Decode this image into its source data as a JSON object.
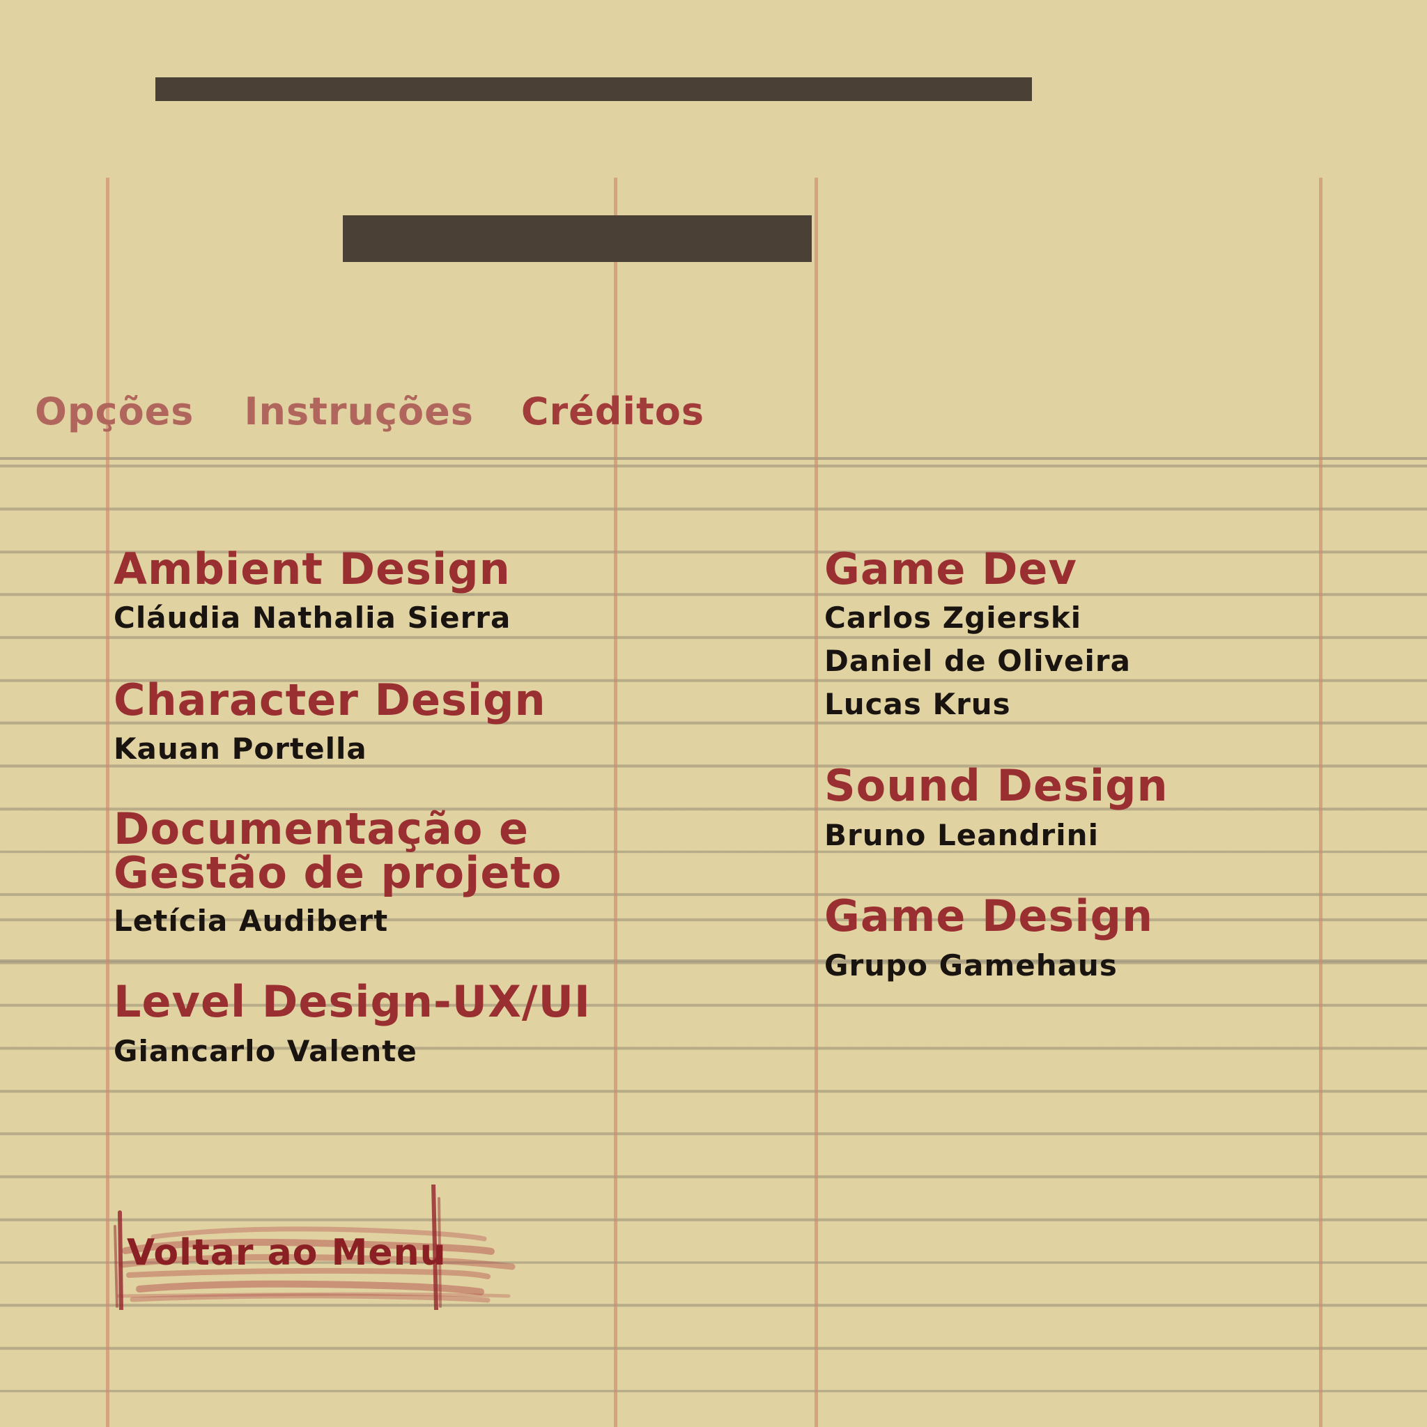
{
  "tabs": [
    {
      "label": "Opções",
      "active": false
    },
    {
      "label": "Instruções",
      "active": false
    },
    {
      "label": "Créditos",
      "active": true
    }
  ],
  "credits_left": [
    {
      "title": "Ambient Design",
      "names": [
        "Cláudia Nathalia Sierra"
      ]
    },
    {
      "title": "Character Design",
      "names": [
        "Kauan Portella"
      ]
    },
    {
      "title_lines": [
        "Documentação e",
        "Gestão de projeto"
      ],
      "names": [
        "Letícia Audibert"
      ]
    },
    {
      "title": "Level Design-UX/UI",
      "names": [
        "Giancarlo Valente"
      ]
    }
  ],
  "credits_right": [
    {
      "title": "Game Dev",
      "names": [
        "Carlos Zgierski",
        "Daniel de Oliveira",
        "Lucas Krus"
      ]
    },
    {
      "title": "Sound Design",
      "names": [
        "Bruno Leandrini"
      ]
    },
    {
      "title": "Game Design",
      "names": [
        "Grupo Gamehaus"
      ]
    }
  ],
  "back_button": {
    "label": "Voltar ao Menu"
  },
  "colors": {
    "paper": "#e1d2a1",
    "redacted_bar": "#4a4035",
    "title_red": "#9a2f32",
    "tab_inactive": "#b0665c",
    "tab_active": "#a23c3a",
    "name_text": "#1a1410"
  }
}
